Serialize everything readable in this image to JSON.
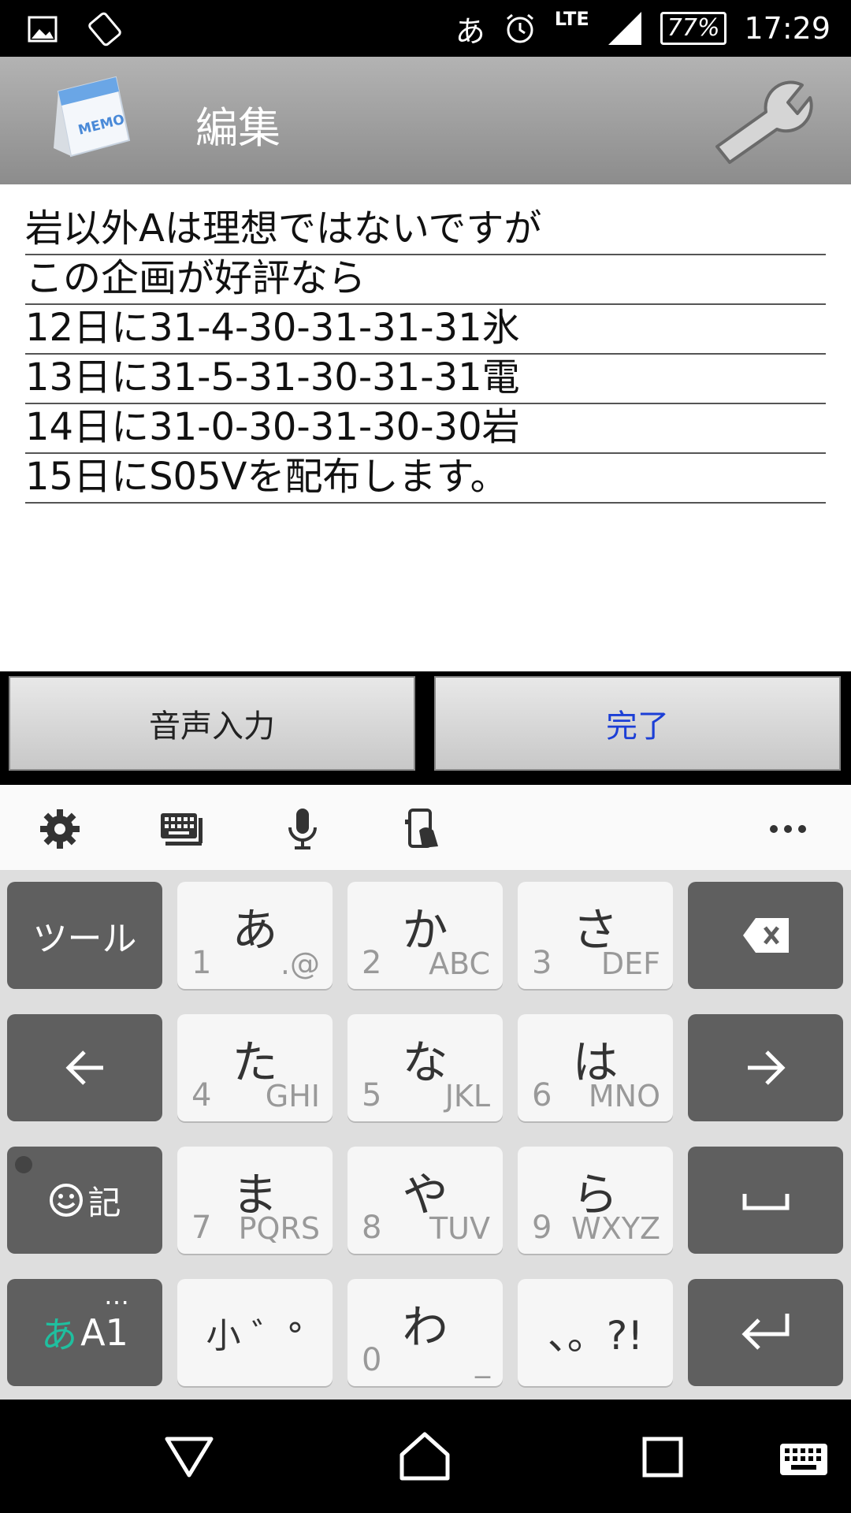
{
  "status": {
    "battery": "77%",
    "time": "17:29",
    "network": "LTE",
    "ime": "あ"
  },
  "appbar": {
    "title": "編集"
  },
  "memo": {
    "lines": [
      "岩以外Aは理想ではないですが",
      "この企画が好評なら",
      "12日に31-4-30-31-31-31氷",
      "13日に31-5-31-30-31-31電",
      "14日に31-0-30-31-30-30岩",
      "15日にS05Vを配布します。"
    ]
  },
  "buttons": {
    "voice": "音声入力",
    "done": "完了"
  },
  "keyboard": {
    "tool": "ツール",
    "emoji": "記",
    "mode_kana": "あ",
    "mode_alpha": "A1",
    "mode_dots": "…",
    "small": "小 ゛°",
    "punct": "、。?!",
    "keys": [
      {
        "kana": "あ",
        "num": "1",
        "sub": ".@"
      },
      {
        "kana": "か",
        "num": "2",
        "sub": "ABC"
      },
      {
        "kana": "さ",
        "num": "3",
        "sub": "DEF"
      },
      {
        "kana": "た",
        "num": "4",
        "sub": "GHI"
      },
      {
        "kana": "な",
        "num": "5",
        "sub": "JKL"
      },
      {
        "kana": "は",
        "num": "6",
        "sub": "MNO"
      },
      {
        "kana": "ま",
        "num": "7",
        "sub": "PQRS"
      },
      {
        "kana": "や",
        "num": "8",
        "sub": "TUV"
      },
      {
        "kana": "ら",
        "num": "9",
        "sub": "WXYZ"
      },
      {
        "kana": "わ",
        "num": "0",
        "sub": "_"
      }
    ]
  },
  "colors": {
    "done_text": "#1c3fd6",
    "accent_kana": "#1fbf9f"
  }
}
